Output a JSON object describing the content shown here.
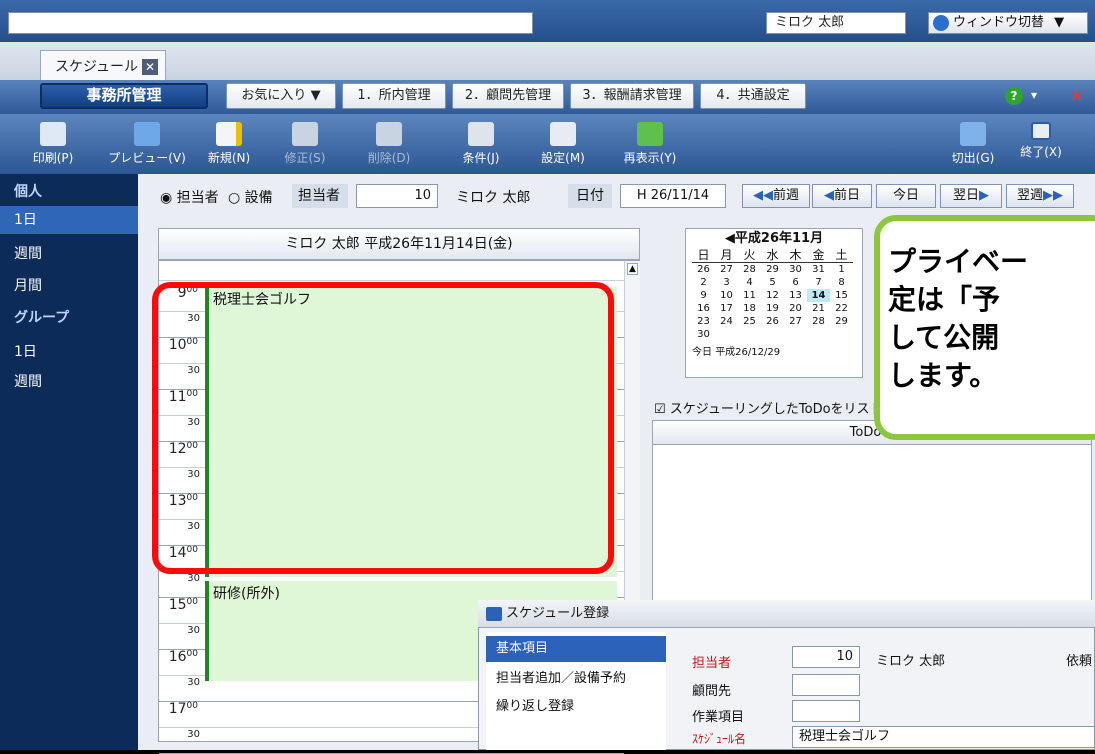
{
  "top": {
    "user_name": "ミロク 太郎",
    "window_switch": "ウィンドウ切替"
  },
  "tab": {
    "label": "スケジュール"
  },
  "menu": {
    "main": "事務所管理",
    "favorites": "お気に入り",
    "items": [
      "1．所内管理",
      "2．顧問先管理",
      "3．報酬請求管理",
      "4．共通設定"
    ]
  },
  "toolbar": [
    {
      "label": "印刷(P)",
      "icon": "printer-icon"
    },
    {
      "label": "プレビュー(V)",
      "icon": "preview-icon"
    },
    {
      "label": "新規(N)",
      "icon": "new-icon"
    },
    {
      "label": "修正(S)",
      "icon": "edit-icon"
    },
    {
      "label": "削除(D)",
      "icon": "delete-icon"
    },
    {
      "label": "条件(J)",
      "icon": "binoculars-icon"
    },
    {
      "label": "設定(M)",
      "icon": "tools-icon"
    },
    {
      "label": "再表示(Y)",
      "icon": "refresh-icon"
    },
    {
      "label": "切出(G)",
      "icon": "export-icon"
    },
    {
      "label": "終了(X)",
      "icon": "close-icon"
    }
  ],
  "sidebar": {
    "personal": "個人",
    "p_day": "1日",
    "p_week": "週間",
    "p_month": "月間",
    "group": "グループ",
    "g_day": "1日",
    "g_week": "週間"
  },
  "filter": {
    "radio_person": "担当者",
    "radio_equipment": "設備",
    "person_label": "担当者",
    "person_code": "10",
    "person_name": "ミロク 太郎",
    "date_label": "日付",
    "date_value": "H 26/11/14",
    "prev_week": "前週",
    "prev_day": "前日",
    "today": "今日",
    "next_day": "翌日",
    "next_week": "翌週"
  },
  "schedule": {
    "header": "ミロク 太郎  平成26年11月14日(金)",
    "hours": [
      "9",
      "10",
      "11",
      "12",
      "13",
      "14",
      "15",
      "16",
      "17"
    ],
    "minute_label": "00",
    "half_label": "30",
    "event1": "税理士会ゴルフ",
    "event2": "研修(所外)"
  },
  "calendar": {
    "title": "平成26年11月",
    "weekdays": [
      "日",
      "月",
      "火",
      "水",
      "木",
      "金",
      "土"
    ],
    "rows": [
      [
        "26",
        "27",
        "28",
        "29",
        "30",
        "31",
        "1"
      ],
      [
        "2",
        "3",
        "4",
        "5",
        "6",
        "7",
        "8"
      ],
      [
        "9",
        "10",
        "11",
        "12",
        "13",
        "14",
        "15"
      ],
      [
        "16",
        "17",
        "18",
        "19",
        "20",
        "21",
        "22"
      ],
      [
        "23",
        "24",
        "25",
        "26",
        "27",
        "28",
        "29"
      ],
      [
        "30",
        "",
        "",
        "",
        "",
        "",
        ""
      ]
    ],
    "today_label": "今日",
    "today_value": "平成26/12/29"
  },
  "todo": {
    "checkbox_label": "スケジューリングしたToDoをリスト",
    "column": "ToDo名"
  },
  "callout": {
    "line1": "プライベー",
    "line2": "定は「予",
    "line3": "して公開",
    "line4": "します。"
  },
  "dialog": {
    "title": "スケジュール登録",
    "nav": [
      "基本項目",
      "担当者追加／設備予約",
      "繰り返し登録"
    ],
    "person_label": "担当者",
    "person_code": "10",
    "person_name": "ミロク 太郎",
    "client_label": "顧問先",
    "task_label": "作業項目",
    "sched_label": "ｽｹｼﾞｭｰﾙ名",
    "sched_value": "税理士会ゴルフ",
    "cut_label": "依頼"
  }
}
